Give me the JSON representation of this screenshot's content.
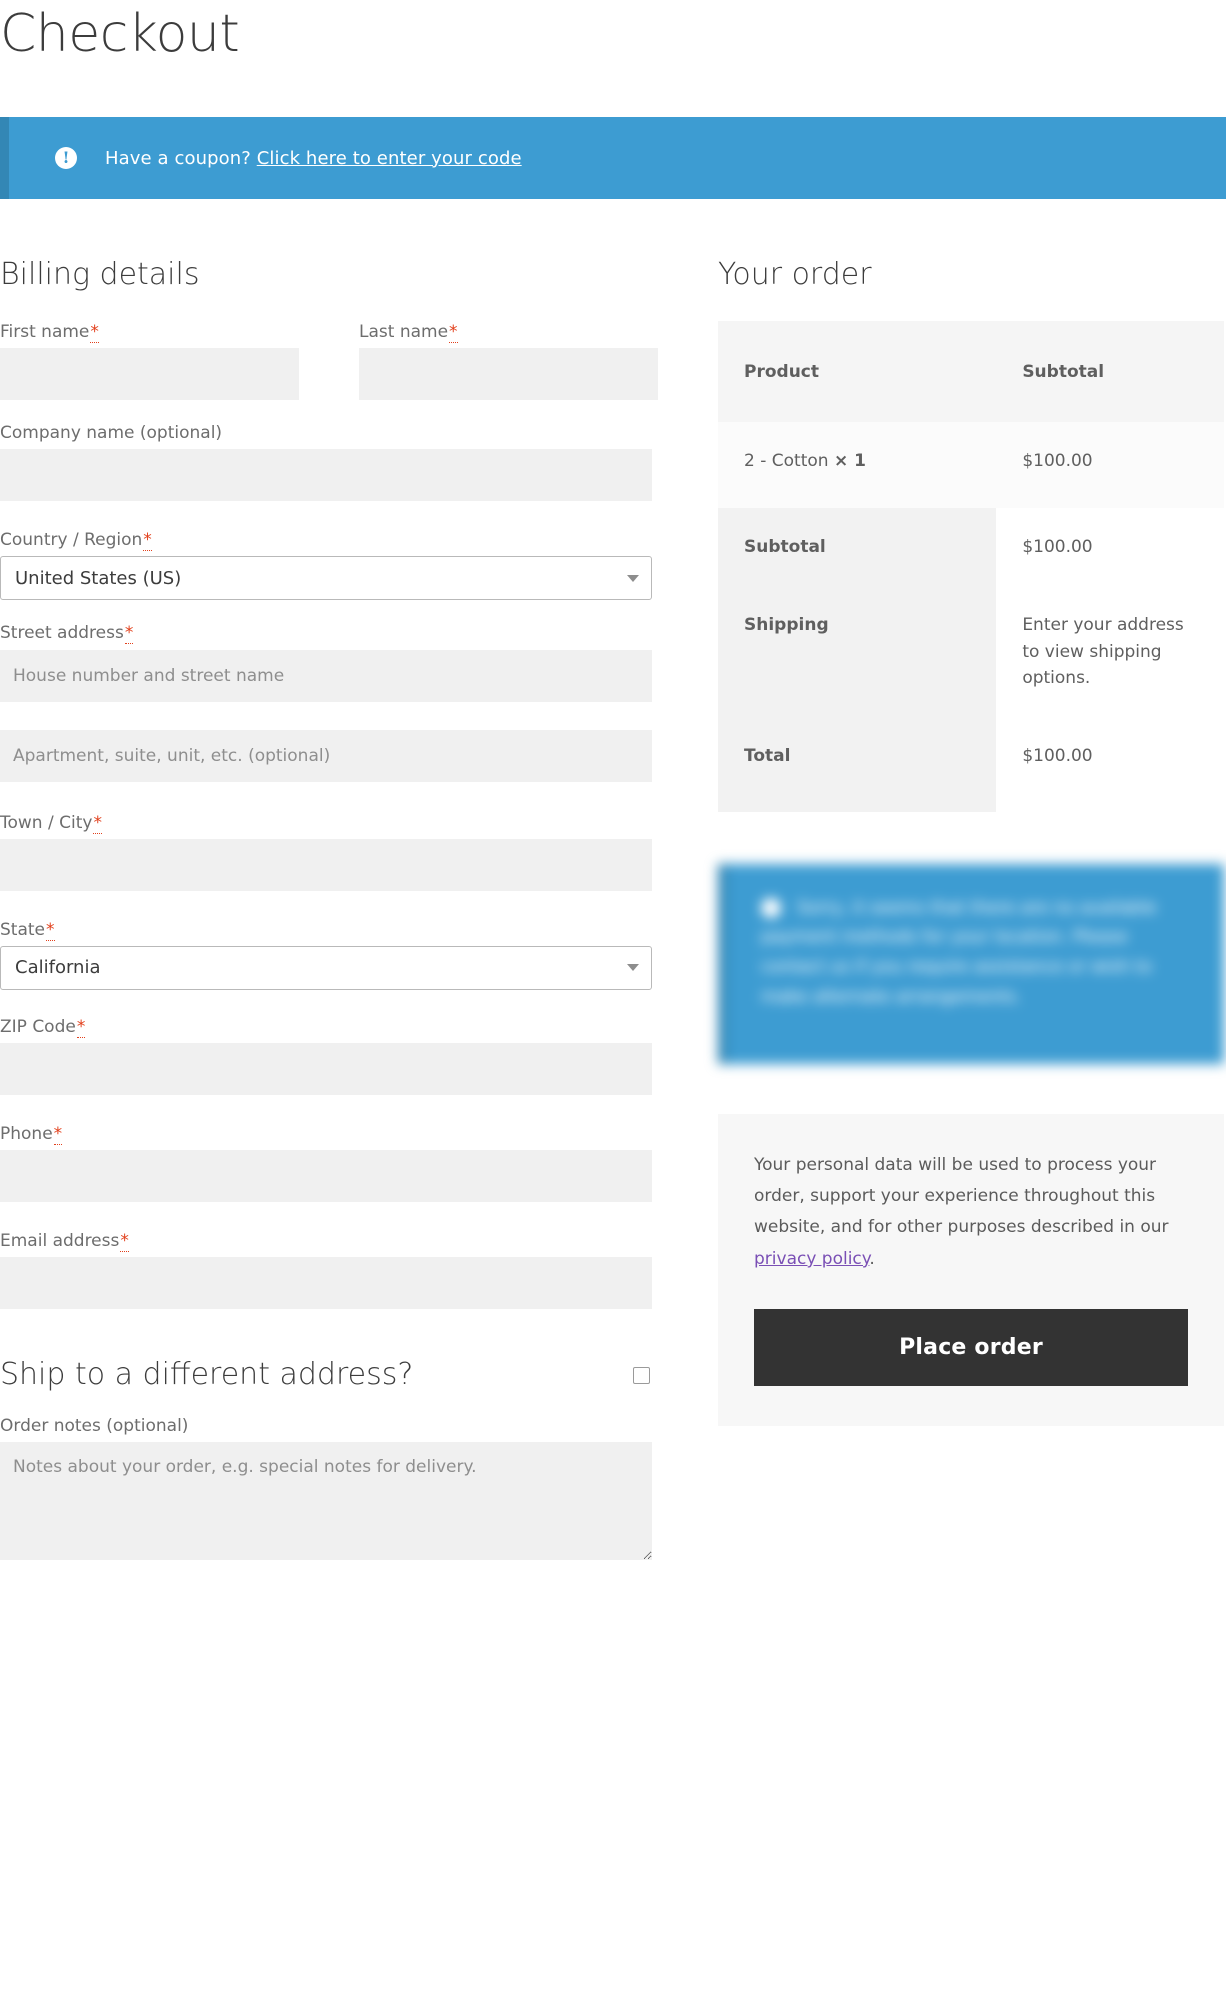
{
  "page": {
    "title": "Checkout"
  },
  "coupon_notice": {
    "icon": "exclamation-circle-icon",
    "text": "Have a coupon?",
    "link_label": "Click here to enter your code",
    "background_color": "#3d9cd2",
    "border_color": "#3387b5"
  },
  "billing": {
    "heading": "Billing details",
    "required_mark": "*",
    "fields": {
      "first_name": {
        "label": "First name",
        "required": true,
        "value": "",
        "placeholder": ""
      },
      "last_name": {
        "label": "Last name",
        "required": true,
        "value": "",
        "placeholder": ""
      },
      "company": {
        "label": "Company name (optional)",
        "required": false,
        "value": "",
        "placeholder": ""
      },
      "country": {
        "label": "Country / Region",
        "required": true,
        "value": "United States (US)"
      },
      "street": {
        "label": "Street address",
        "required": true,
        "value": "",
        "placeholder": "House number and street name"
      },
      "street2": {
        "label": "",
        "required": false,
        "value": "",
        "placeholder": "Apartment, suite, unit, etc. (optional)"
      },
      "city": {
        "label": "Town / City",
        "required": true,
        "value": "",
        "placeholder": ""
      },
      "state": {
        "label": "State",
        "required": true,
        "value": "California"
      },
      "zip": {
        "label": "ZIP Code",
        "required": true,
        "value": "",
        "placeholder": ""
      },
      "phone": {
        "label": "Phone",
        "required": true,
        "value": "",
        "placeholder": ""
      },
      "email": {
        "label": "Email address",
        "required": true,
        "value": "",
        "placeholder": ""
      }
    }
  },
  "shipping_section": {
    "heading": "Ship to a different address?",
    "checkbox_checked": false
  },
  "order_notes": {
    "label": "Order notes (optional)",
    "value": "",
    "placeholder": "Notes about your order, e.g. special notes for delivery."
  },
  "order": {
    "heading": "Your order",
    "columns": {
      "product": "Product",
      "subtotal": "Subtotal"
    },
    "items": [
      {
        "name": "2 - Cotton",
        "quantity": "× 1",
        "subtotal": "$100.00"
      }
    ],
    "totals": [
      {
        "label": "Subtotal",
        "value": "$100.00"
      },
      {
        "label": "Shipping",
        "value": "Enter your address to view shipping options."
      },
      {
        "label": "Total",
        "value": "$100.00"
      }
    ]
  },
  "payment_notice": {
    "blurred": true,
    "text": "Sorry, it seems that there are no available payment methods for your location. Please contact us if you require assistance or wish to make alternate arrangements.",
    "background_color": "#3d9cd2"
  },
  "privacy": {
    "text_before": "Your personal data will be used to process your order, support your experience throughout this website, and for other purposes described in our ",
    "link_label": "privacy policy",
    "text_after": ".",
    "link_color": "#7a4fb5"
  },
  "place_order": {
    "label": "Place order",
    "background_color": "#333333"
  }
}
